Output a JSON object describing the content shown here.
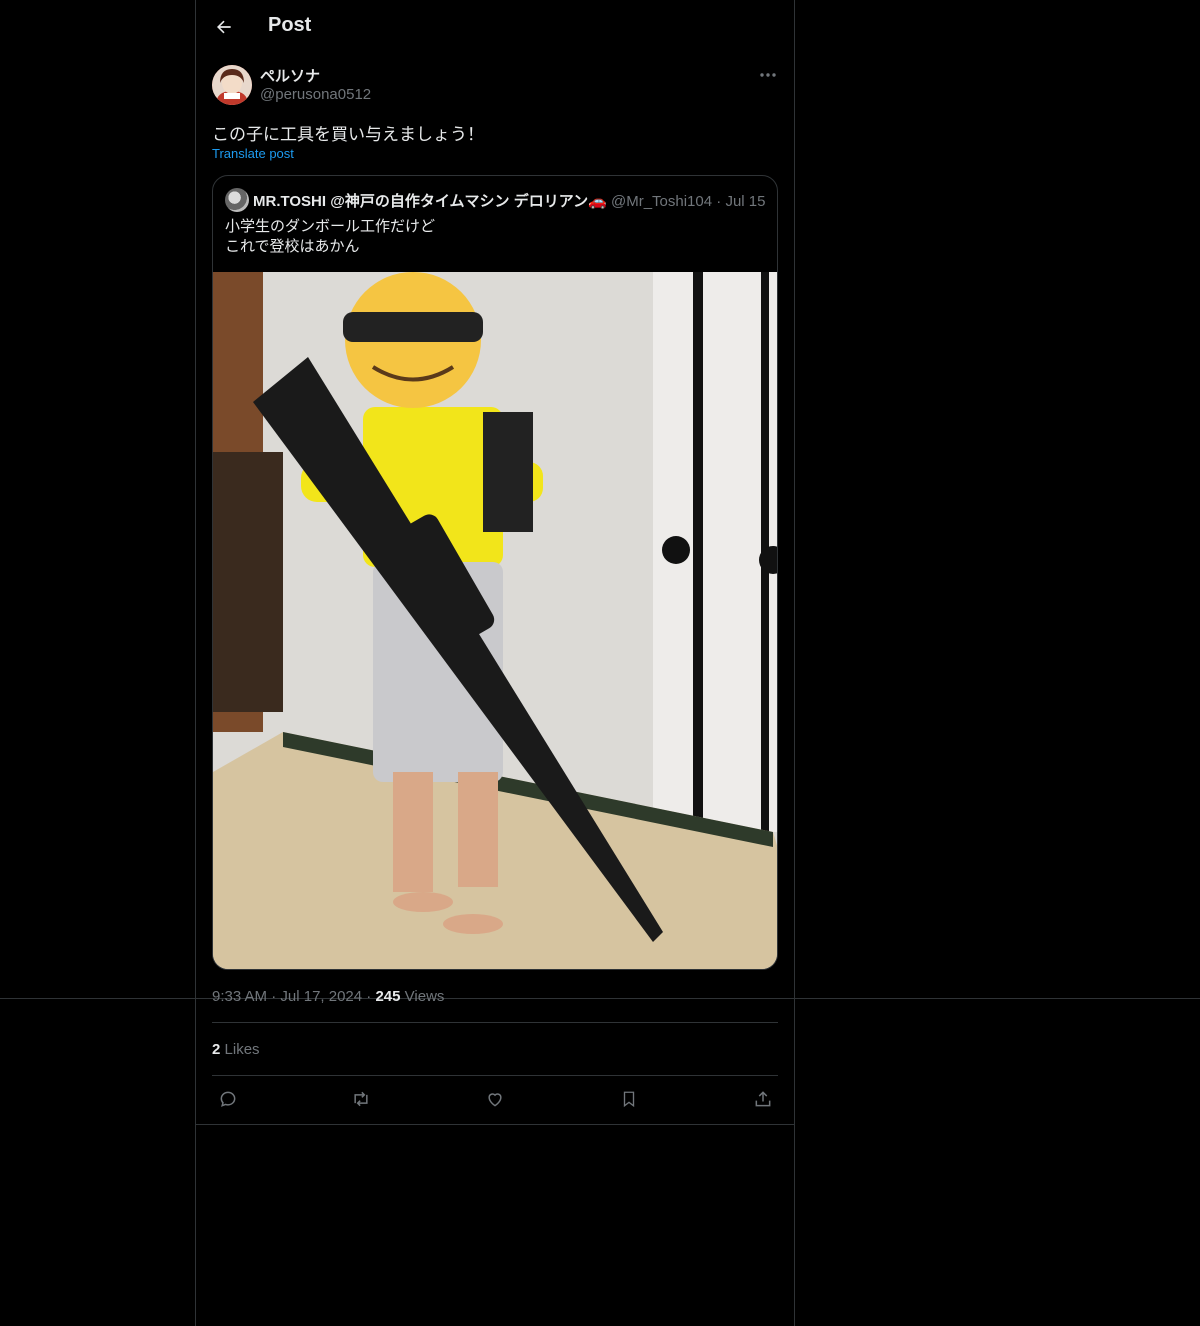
{
  "topbar": {
    "title": "Post"
  },
  "post": {
    "author_name": "ペルソナ",
    "author_handle": "@perusona0512",
    "text": "この子に工具を買い与えましょう！",
    "translate_label": "Translate post",
    "time": "9:33 AM",
    "date": "Jul 17, 2024",
    "views_count": "245",
    "views_label": "Views",
    "likes_count": "2",
    "likes_label": "Likes"
  },
  "quote": {
    "author_name": "MR.TOSHI @神戸の自作タイムマシン デロリアン🚗",
    "author_handle": "@Mr_Toshi104",
    "date": "Jul 15",
    "text_line1": "小学生のダンボール工作だけど",
    "text_line2": "これで登校はあかん"
  },
  "actions": [
    "reply-icon",
    "repost-icon",
    "like-icon",
    "bookmark-icon",
    "share-icon"
  ],
  "colors": {
    "background": "#000000",
    "border": "#2f3336",
    "text": "#e7e9ea",
    "muted": "#71767b",
    "accent": "#1d9bf0"
  }
}
